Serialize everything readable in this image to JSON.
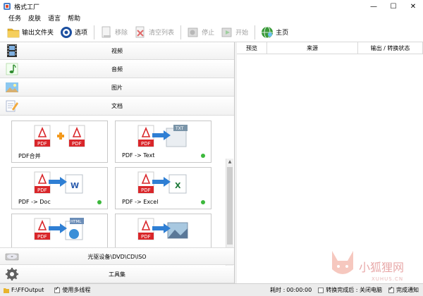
{
  "window": {
    "title": "格式工厂",
    "controls": {
      "minimize": "—",
      "maximize": "☐",
      "close": "✕"
    }
  },
  "menu": [
    "任务",
    "皮肤",
    "语言",
    "帮助"
  ],
  "toolbar": {
    "output_folder": "输出文件夹",
    "options": "选项",
    "remove": "移除",
    "clear_list": "清空列表",
    "stop": "停止",
    "start": "开始",
    "home": "主页"
  },
  "categories": {
    "video": "视频",
    "audio": "音频",
    "image": "图片",
    "document": "文档",
    "optical": "光驱设备\\DVD\\CD\\ISO",
    "tools": "工具集"
  },
  "tiles": [
    {
      "label": "PDF合并",
      "icon": "pdf-merge-icon",
      "status_dot": false
    },
    {
      "label": "PDF -> Text",
      "icon": "pdf-to-text-icon",
      "status_dot": true
    },
    {
      "label": "PDF -> Doc",
      "icon": "pdf-to-doc-icon",
      "status_dot": true
    },
    {
      "label": "PDF -> Excel",
      "icon": "pdf-to-excel-icon",
      "status_dot": true
    },
    {
      "label": "",
      "icon": "pdf-to-html-icon",
      "status_dot": false
    },
    {
      "label": "",
      "icon": "pdf-to-image-icon",
      "status_dot": false
    }
  ],
  "tile_art_text": {
    "pdf": "PDF",
    "txt": "TXT",
    "word": "W",
    "excel": "X",
    "html": "HTML"
  },
  "task_table": {
    "columns": [
      "预览",
      "来源",
      "输出 / 转换状态"
    ]
  },
  "status": {
    "output_path": "F:\\FFOutput",
    "multithread": "使用多线程",
    "elapsed_label": "耗时 :",
    "elapsed": "00:00:00",
    "after_convert": "转换完成后 : 关闭电脑",
    "notify": "完成通知"
  },
  "watermark": {
    "text": "小狐狸网",
    "sub": "XUHUS.CN"
  },
  "colors": {
    "pdf_red": "#d9262a",
    "arrow_blue": "#2f7fd4",
    "status_green": "#3cb83c",
    "plus_orange": "#f39a1e"
  }
}
